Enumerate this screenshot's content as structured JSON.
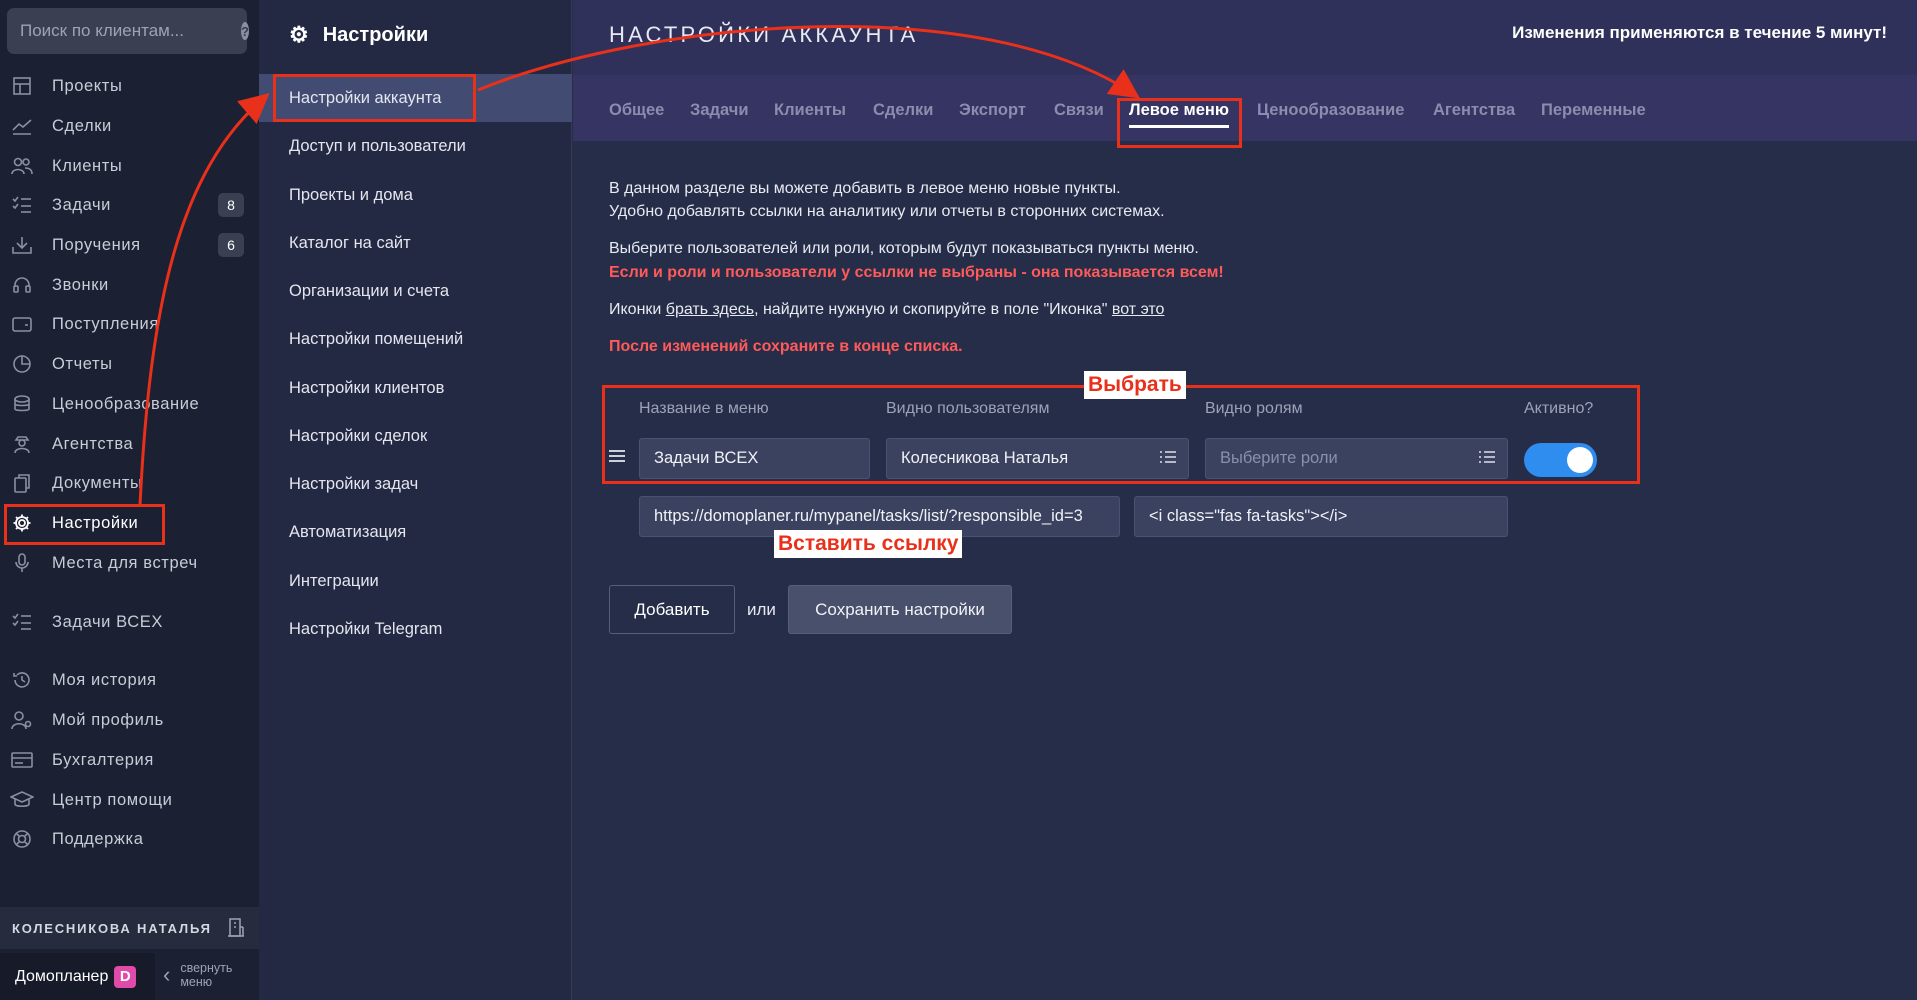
{
  "search": {
    "placeholder": "Поиск по клиентам..."
  },
  "leftnav": {
    "items": [
      {
        "label": "Проекты",
        "icon": "projects-icon"
      },
      {
        "label": "Сделки",
        "icon": "deals-icon"
      },
      {
        "label": "Клиенты",
        "icon": "clients-icon"
      },
      {
        "label": "Задачи",
        "icon": "tasks-icon",
        "badge": "8"
      },
      {
        "label": "Поручения",
        "icon": "assignments-icon",
        "badge": "6"
      },
      {
        "label": "Звонки",
        "icon": "calls-icon"
      },
      {
        "label": "Поступления",
        "icon": "income-icon"
      },
      {
        "label": "Отчеты",
        "icon": "reports-icon"
      },
      {
        "label": "Ценообразование",
        "icon": "pricing-icon"
      },
      {
        "label": "Агентства",
        "icon": "agencies-icon"
      },
      {
        "label": "Документы",
        "icon": "documents-icon"
      },
      {
        "label": "Настройки",
        "icon": "gear-icon",
        "active": true
      },
      {
        "label": "Места для встреч",
        "icon": "meeting-icon"
      },
      {
        "label": "Задачи ВСЕХ",
        "icon": "tasks-icon"
      },
      {
        "label": "Моя история",
        "icon": "history-icon"
      },
      {
        "label": "Мой профиль",
        "icon": "profile-icon"
      },
      {
        "label": "Бухгалтерия",
        "icon": "accounting-icon"
      },
      {
        "label": "Центр помощи",
        "icon": "help-center-icon"
      },
      {
        "label": "Поддержка",
        "icon": "support-icon"
      }
    ],
    "user_name": "КОЛЕСНИКОВА НАТАЛЬЯ",
    "brand": "Домопланер",
    "brand_logo": "D",
    "collapse_label_1": "свернуть",
    "collapse_label_2": "меню"
  },
  "settings_nav": {
    "title": "Настройки",
    "items": [
      "Настройки аккаунта",
      "Доступ и пользователи",
      "Проекты и дома",
      "Каталог на сайт",
      "Организации и счета",
      "Настройки помещений",
      "Настройки клиентов",
      "Настройки сделок",
      "Настройки задач",
      "Автоматизация",
      "Интеграции",
      "Настройки Telegram"
    ],
    "active_index": 0
  },
  "main": {
    "title": "НАСТРОЙКИ АККАУНТА",
    "notice": "Изменения применяются в течение 5 минут!",
    "tabs": [
      "Общее",
      "Задачи",
      "Клиенты",
      "Сделки",
      "Экспорт",
      "Связи",
      "Левое меню",
      "Ценообразование",
      "Агентства",
      "Переменные"
    ],
    "active_tab": "Левое меню",
    "intro_1": "В данном разделе вы можете добавить в левое меню новые пункты.",
    "intro_2": "Удобно добавлять ссылки на аналитику или отчеты в сторонних системах.",
    "intro_3": "Выберите пользователей или роли, которым будут показываться пункты меню.",
    "warning_1": "Если и роли и пользователи у ссылки не выбраны - она показывается всем!",
    "icons_prefix": "Иконки ",
    "icons_link": "брать здесь",
    "icons_middle": ", найдите нужную и скопируйте в поле \"Иконка\" ",
    "icons_link_2": "вот это",
    "warning_2": "После изменений сохраните в конце списка.",
    "columns": {
      "name": "Название в меню",
      "users": "Видно пользователям",
      "roles": "Видно ролям",
      "active": "Активно?"
    },
    "row": {
      "name": "Задачи ВСЕХ",
      "users": "Колесникова Наталья",
      "roles_placeholder": "Выберите роли",
      "active": true,
      "url": "https://domoplaner.ru/mypanel/tasks/list/?responsible_id=3",
      "icon_code": "<i class=\"fas fa-tasks\"></i>"
    },
    "add_button": "Добавить",
    "or_text": "или",
    "save_button": "Сохранить настройки"
  },
  "annotations": {
    "choose": "Выбрать",
    "paste_link": "Вставить ссылку",
    "color": "#e8301b"
  }
}
